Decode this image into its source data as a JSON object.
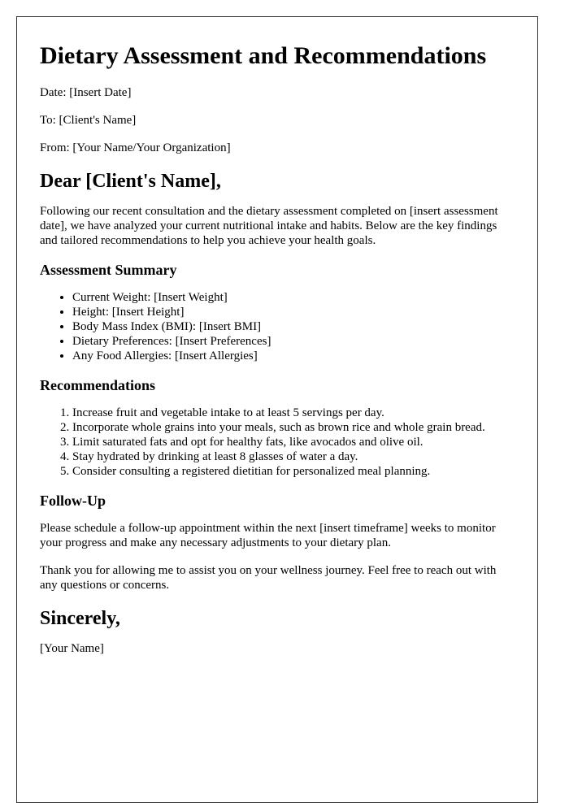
{
  "title": "Dietary Assessment and Recommendations",
  "meta": {
    "date": "Date: [Insert Date]",
    "to": "To: [Client's Name]",
    "from": "From: [Your Name/Your Organization]"
  },
  "salutation": "Dear [Client's Name],",
  "intro": "Following our recent consultation and the dietary assessment completed on [insert assessment date], we have analyzed your current nutritional intake and habits. Below are the key findings and tailored recommendations to help you achieve your health goals.",
  "assessment": {
    "heading": "Assessment Summary",
    "items": [
      "Current Weight: [Insert Weight]",
      "Height: [Insert Height]",
      "Body Mass Index (BMI): [Insert BMI]",
      "Dietary Preferences: [Insert Preferences]",
      "Any Food Allergies: [Insert Allergies]"
    ]
  },
  "recommendations": {
    "heading": "Recommendations",
    "items": [
      "Increase fruit and vegetable intake to at least 5 servings per day.",
      "Incorporate whole grains into your meals, such as brown rice and whole grain bread.",
      "Limit saturated fats and opt for healthy fats, like avocados and olive oil.",
      "Stay hydrated by drinking at least 8 glasses of water a day.",
      "Consider consulting a registered dietitian for personalized meal planning."
    ]
  },
  "followup": {
    "heading": "Follow-Up",
    "paragraph": "Please schedule a follow-up appointment within the next [insert timeframe] weeks to monitor your progress and make any necessary adjustments to your dietary plan.",
    "closing_paragraph": "Thank you for allowing me to assist you on your wellness journey. Feel free to reach out with any questions or concerns."
  },
  "signoff": "Sincerely,",
  "signature": "[Your Name]"
}
